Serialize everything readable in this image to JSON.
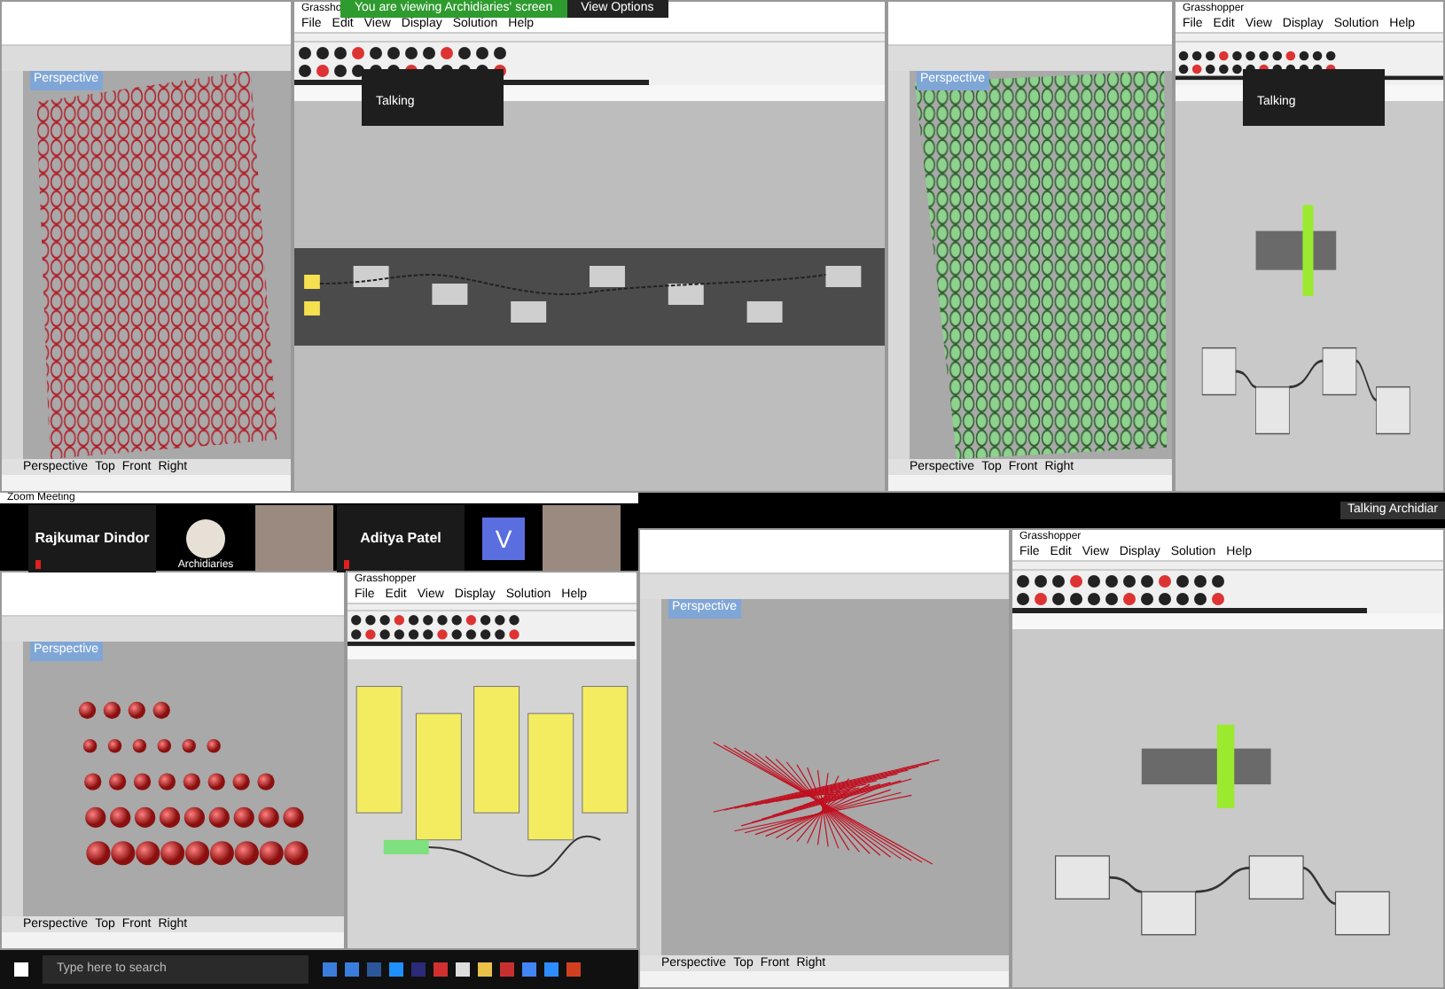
{
  "share_banner": {
    "text": "You are viewing Archidiaries' screen",
    "button": "View Options"
  },
  "top_windows": [
    {
      "kind": "rhino",
      "viewport": "Perspective",
      "view_tabs": [
        "Perspective",
        "Top",
        "Front",
        "Right"
      ],
      "content": {
        "kind": "red_hex"
      }
    },
    {
      "kind": "grasshopper",
      "title": "Grassho",
      "menu": [
        "File",
        "Edit",
        "View",
        "Display",
        "Solution",
        "Help"
      ],
      "content": {
        "kind": "dark"
      },
      "overlay": "Talking"
    },
    {
      "kind": "rhino",
      "viewport": "Perspective",
      "view_tabs": [
        "Perspective",
        "Top",
        "Front",
        "Right"
      ],
      "content": {
        "kind": "green_hex"
      }
    },
    {
      "kind": "grasshopper",
      "title": "Grasshopper",
      "menu": [
        "File",
        "Edit",
        "View",
        "Display",
        "Solution",
        "Help"
      ],
      "content": {
        "kind": "light"
      },
      "overlay": "Talking"
    }
  ],
  "meeting": {
    "title": "Zoom Meeting",
    "participants": [
      {
        "kind": "name",
        "name": "Rajkumar Dindor"
      },
      {
        "kind": "avatar",
        "name": "Archidiaries"
      },
      {
        "kind": "photo"
      },
      {
        "kind": "name",
        "name": "Aditya Patel"
      },
      {
        "kind": "letter",
        "name": "V"
      },
      {
        "kind": "photo"
      }
    ],
    "talking": "Talking Archidiar"
  },
  "bottom_windows": [
    {
      "kind": "rhino",
      "viewport": "Perspective",
      "view_tabs": [
        "Perspective",
        "Top",
        "Front",
        "Right"
      ],
      "content": {
        "kind": "spheres"
      }
    },
    {
      "kind": "grasshopper",
      "title": "Grasshopper",
      "menu": [
        "File",
        "Edit",
        "View",
        "Display",
        "Solution",
        "Help"
      ],
      "content": {
        "kind": "panels"
      }
    },
    {
      "kind": "rhino",
      "viewport": "Perspective",
      "view_tabs": [
        "Perspective",
        "Top",
        "Front",
        "Right"
      ],
      "content": {
        "kind": "lines"
      }
    },
    {
      "kind": "grasshopper",
      "title": "Grasshopper",
      "menu": [
        "File",
        "Edit",
        "View",
        "Display",
        "Solution",
        "Help"
      ],
      "content": {
        "kind": "light"
      }
    }
  ],
  "taskbar": {
    "search_placeholder": "Type here to search"
  }
}
